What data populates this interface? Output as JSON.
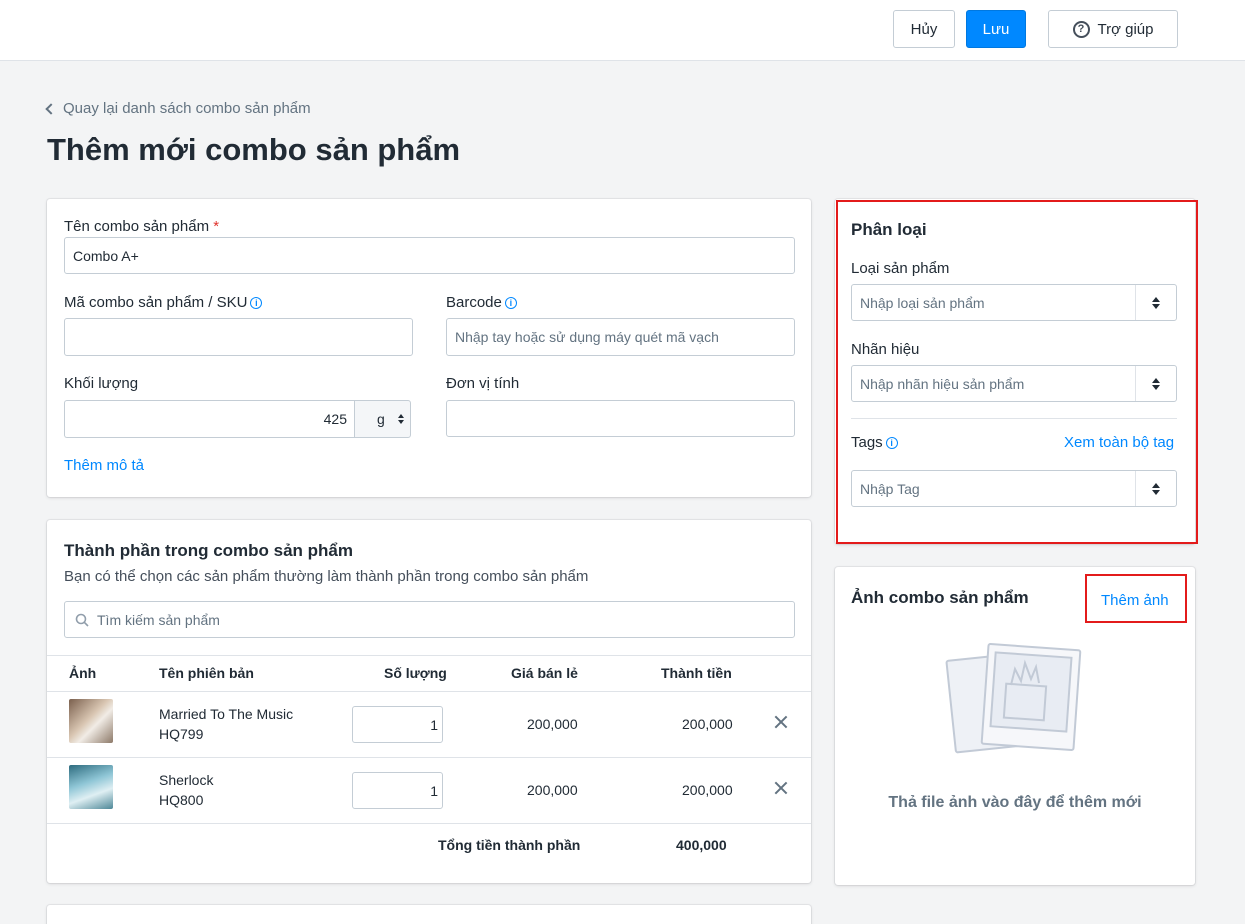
{
  "topbar": {
    "cancel_label": "Hủy",
    "save_label": "Lưu",
    "help_label": "Trợ giúp",
    "help_icon": "question-circle-icon"
  },
  "back_link": "Quay lại danh sách combo sản phẩm",
  "page_title": "Thêm mới combo sản phẩm",
  "info_card": {
    "name_label": "Tên combo sản phẩm",
    "required_mark": "*",
    "name_value": "Combo A+",
    "sku_label": "Mã combo sản phẩm / SKU",
    "sku_value": "",
    "barcode_label": "Barcode",
    "barcode_placeholder": "Nhập tay hoặc sử dụng máy quét mã vạch",
    "weight_label": "Khối lượng",
    "weight_value": "425",
    "weight_unit": "g",
    "unit_label": "Đơn vị tính",
    "unit_value": "",
    "add_description": "Thêm mô tả"
  },
  "components": {
    "title": "Thành phần trong combo sản phẩm",
    "subtitle": "Bạn có thể chọn các sản phẩm thường làm thành phần trong combo sản phẩm",
    "search_placeholder": "Tìm kiếm sản phẩm",
    "columns": [
      "Ảnh",
      "Tên phiên bản",
      "Số lượng",
      "Giá bán lẻ",
      "Thành tiền"
    ],
    "rows": [
      {
        "name": "Married To The Music",
        "sku": "HQ799",
        "qty": "1",
        "price": "200,000",
        "total": "200,000"
      },
      {
        "name": "Sherlock",
        "sku": "HQ800",
        "qty": "1",
        "price": "200,000",
        "total": "200,000"
      }
    ],
    "total_label": "Tổng tiền thành phần",
    "total_value": "400,000"
  },
  "classification": {
    "title": "Phân loại",
    "type_label": "Loại sản phẩm",
    "type_placeholder": "Nhập loại sản phẩm",
    "brand_label": "Nhãn hiệu",
    "brand_placeholder": "Nhập nhãn hiệu sản phẩm",
    "tags_label": "Tags",
    "view_all_tags": "Xem toàn bộ tag",
    "tags_placeholder": "Nhập Tag"
  },
  "images": {
    "title": "Ảnh combo sản phẩm",
    "add_label": "Thêm ảnh",
    "drop_text": "Thả file ảnh vào đây để thêm mới"
  },
  "colors": {
    "accent": "#0088ff",
    "highlight": "#e31b1b"
  }
}
